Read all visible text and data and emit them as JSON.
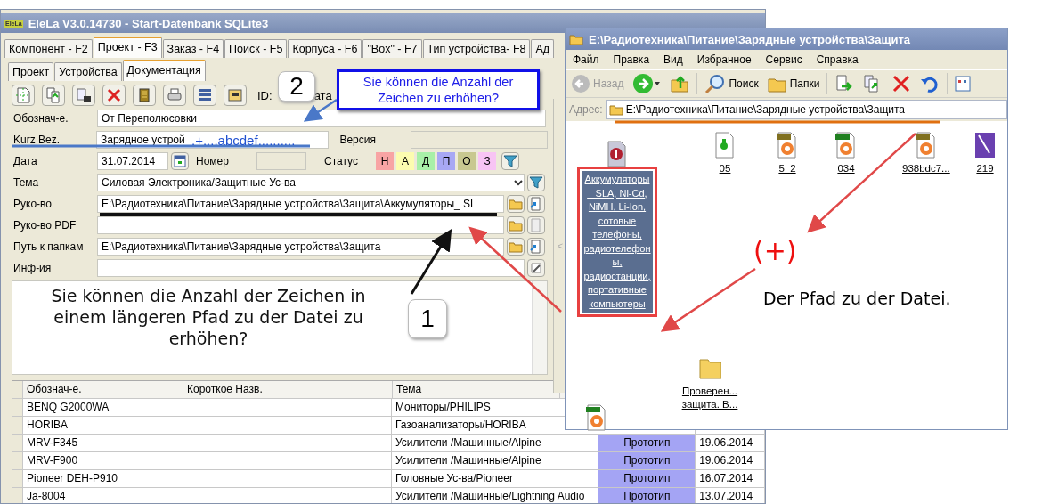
{
  "left_window": {
    "title": "EleLa V3.0.14730  - Start-Datenbank SQLite3",
    "logo": "EleLa",
    "splitter": "<",
    "tabs": [
      {
        "label": "Компонент - F2",
        "selected": false
      },
      {
        "label": "Проект - F3",
        "selected": true
      },
      {
        "label": "Заказ - F4",
        "selected": false
      },
      {
        "label": "Поиск - F5",
        "selected": false
      },
      {
        "label": "Корпуса - F6",
        "selected": false
      },
      {
        "label": "\"Box\" - F7",
        "selected": false
      },
      {
        "label": "Тип устройства- F8",
        "selected": false
      },
      {
        "label": "Ад",
        "selected": false
      }
    ],
    "subtabs": [
      {
        "label": "Проект",
        "selected": false
      },
      {
        "label": "Устройства",
        "selected": false
      },
      {
        "label": "Документация",
        "selected": true
      }
    ],
    "toolbar": {
      "buttons": [
        {
          "kind": "new"
        },
        {
          "kind": "copy"
        },
        {
          "kind": "paste"
        },
        {
          "kind": "delete"
        },
        {
          "kind": "book"
        },
        {
          "kind": "print"
        },
        {
          "kind": "list"
        },
        {
          "kind": "window"
        }
      ],
      "id_label": "ID:",
      "date_label": "ата"
    },
    "form": {
      "designation": {
        "label": "Обознач-е.",
        "value": "От Переполюсовки"
      },
      "short_name": {
        "label": "Kurz Bez.",
        "value": "Зарядное устрой"
      },
      "version": {
        "label": "Версия"
      },
      "date": {
        "label": "Дата",
        "value": "31.07.2014"
      },
      "number": {
        "label": "Номер"
      },
      "status": {
        "label": "Статус",
        "buttons": [
          {
            "label": "Н",
            "color": "#f8a4a4"
          },
          {
            "label": "А",
            "color": "#fcfcb0"
          },
          {
            "label": "Д",
            "color": "#a8f0a8"
          },
          {
            "label": "П",
            "color": "#a8a8f4"
          },
          {
            "label": "О",
            "color": "#c8c890"
          },
          {
            "label": "З",
            "color": "#f8c4f4"
          }
        ]
      },
      "topic": {
        "label": "Тема",
        "value": "Силовая Электроника/Защитные Ус-ва"
      },
      "manual": {
        "label": "Руко-во",
        "value": "E:\\Радиотехника\\Питание\\Зарядные устройства\\Защита\\Аккумуляторы_ SL"
      },
      "manual_pdf": {
        "label": "Руко-во PDF"
      },
      "folder_path": {
        "label": "Путь к папкам",
        "value": "E:\\Радиотехника\\Питание\\Зарядные устройства\\Защита"
      },
      "info": {
        "label": "Инф-ия"
      }
    },
    "grid": {
      "columns": [
        "Обознач-е.",
        "Короткое Назв.",
        "Тема"
      ],
      "rows": [
        {
          "designation": "BENQ G2000WA",
          "topic": "Мониторы/PHILIPS"
        },
        {
          "designation": "HORIBA",
          "topic": "Газоанализаторы/HORIBA"
        },
        {
          "designation": "MRV-F345",
          "topic": "Усилители /Машинные/Alpine",
          "status": "Прототип",
          "date": "19.06.2014"
        },
        {
          "designation": "MRV-F900",
          "topic": "Усилители /Машинные/Alpine",
          "status": "Прототип",
          "date": "19.06.2014"
        },
        {
          "designation": "Pioneer DEH-P910",
          "topic": "Головные Ус-ва/Pioneer",
          "status": "Прототип",
          "date": "16.07.2014"
        },
        {
          "designation": "Ja-8004",
          "topic": "Усилители /Машинные/Lightning Audio",
          "status": "Прототип",
          "date": "13.07.2014"
        }
      ]
    }
  },
  "explorer": {
    "title": "E:\\Радиотехника\\Питание\\Зарядные устройства\\Защита",
    "menu": [
      "Файл",
      "Правка",
      "Вид",
      "Избранное",
      "Сервис",
      "Справка"
    ],
    "toolbar": {
      "back": {
        "label": "Назад",
        "disabled": true
      },
      "search": "Поиск",
      "folders": "Папки"
    },
    "address": {
      "label": "Адрес:",
      "value": "E:\\Радиотехника\\Питание\\Зарядные устройства\\Защита"
    },
    "items": [
      {
        "kind": "app",
        "label": "05",
        "selected": false
      },
      {
        "kind": "jpg",
        "label": "5_2",
        "selected": false
      },
      {
        "kind": "gif",
        "label": "034",
        "selected": false
      },
      {
        "kind": "jpg",
        "label": "938bdc7...",
        "selected": false
      },
      {
        "kind": "book",
        "label": "219",
        "selected": false
      },
      {
        "kind": "pdf",
        "label": "Аккумуляторы_ SLA, Ni-Cd, NiMH, Li-Ion, сотовые телефоны, радиотелефоны, радиостанции, портативные компьютеры",
        "selected": true
      },
      {
        "kind": "folder",
        "label": "Проверен... защита. В...",
        "selected": false
      },
      {
        "kind": "gif"
      }
    ]
  },
  "annotations": {
    "callout_2": "2",
    "note": "Sie können die Anzahl der Zeichen zu erhöhen?",
    "kurz_suffix": ".+....abcdef..........",
    "memo_note": "Sie können die Anzahl der Zeichen in einem längeren Pfad zu der Datei zu erhöhen?",
    "callout_1": "1",
    "plus": "(+)",
    "path_note": "Der Pfad zu der Datei."
  }
}
